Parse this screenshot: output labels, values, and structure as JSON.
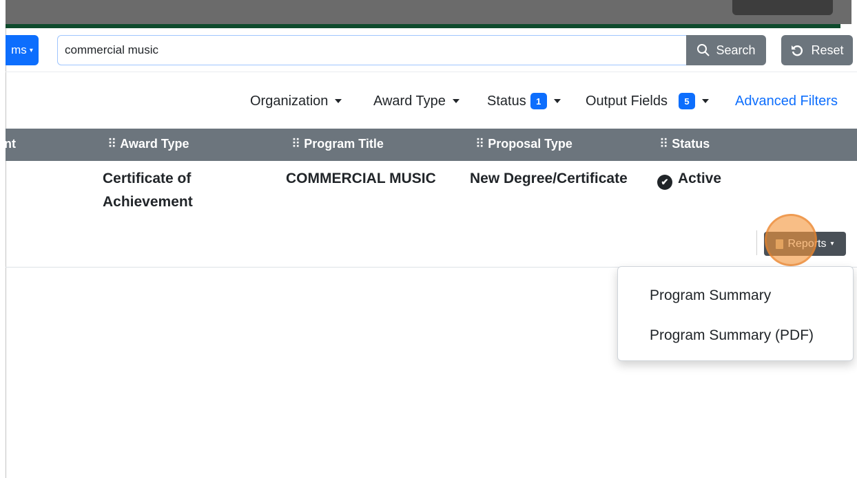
{
  "toolbar": {
    "programs_label": "ms",
    "search_value": "commercial music",
    "search_label": "Search",
    "reset_label": "Reset"
  },
  "filters": {
    "organization": "Organization",
    "award_type": "Award Type",
    "status": "Status",
    "status_count": "1",
    "output_fields": "Output Fields",
    "output_fields_count": "5",
    "advanced": "Advanced Filters"
  },
  "table": {
    "headers": [
      "nt",
      "Award Type",
      "Program Title",
      "Proposal Type",
      "Status"
    ],
    "row": {
      "award_type_line1": "Certificate of",
      "award_type_line2": "Achievement",
      "program_title": "COMMERCIAL MUSIC",
      "proposal_type": "New Degree/Certificate",
      "status": "Active"
    }
  },
  "reports": {
    "button_label": "Reports",
    "menu": [
      "Program Summary",
      "Program Summary (PDF)"
    ]
  },
  "colors": {
    "primary": "#0d6efd",
    "secondary": "#6c757d",
    "header_green": "#0e4a2c"
  }
}
